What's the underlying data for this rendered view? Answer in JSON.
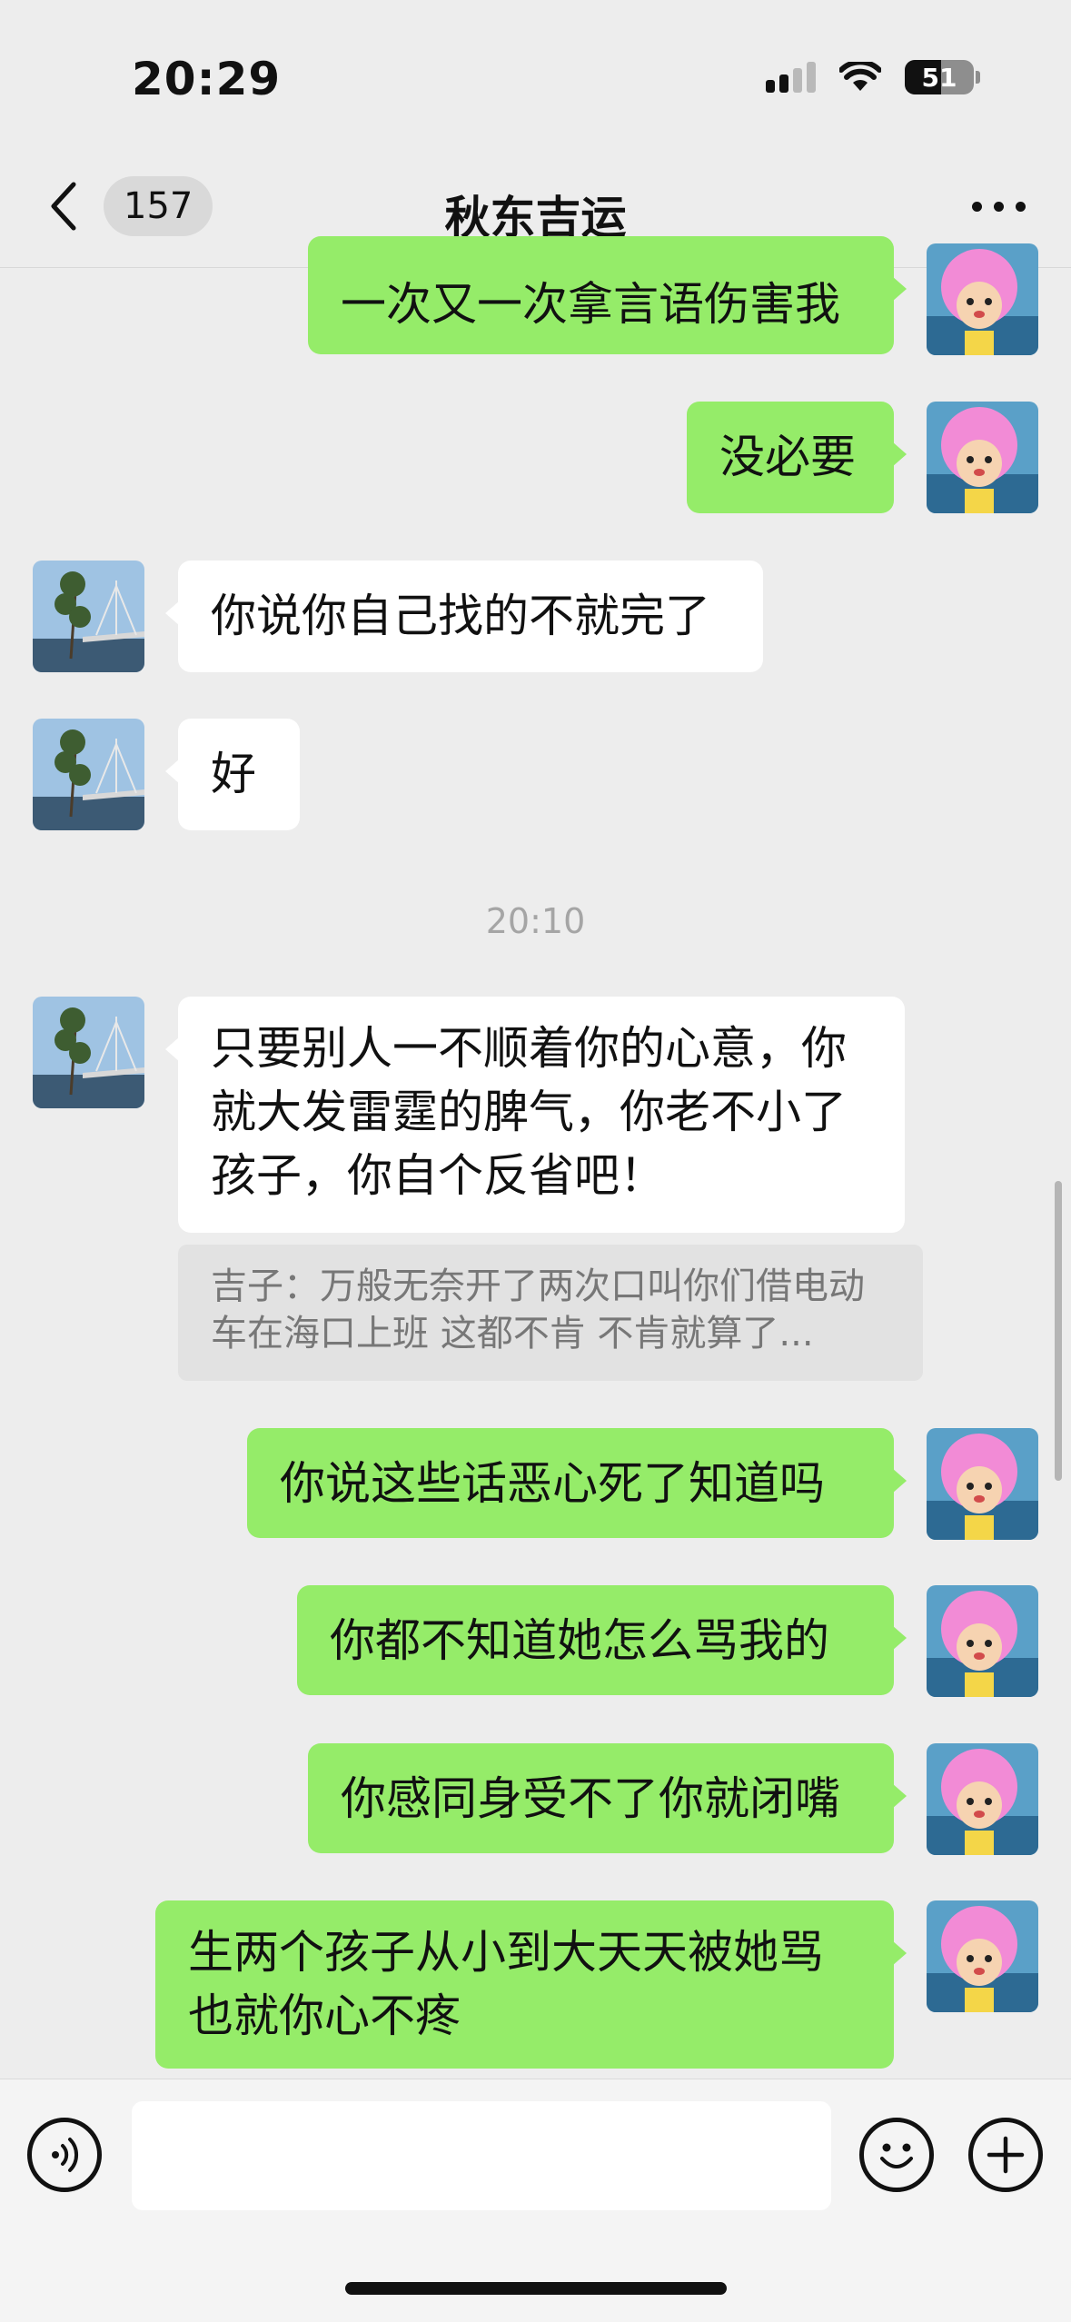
{
  "status_bar": {
    "time": "20:29",
    "battery": "51"
  },
  "header": {
    "unread_count": "157",
    "title": "秋东吉运"
  },
  "messages": [
    {
      "side": "right",
      "text": "一次又一次拿言语伤害我"
    },
    {
      "side": "right",
      "text": "没必要"
    },
    {
      "side": "left",
      "text": "你说你自己找的不就完了"
    },
    {
      "side": "left",
      "text": "好"
    },
    {
      "side": "left",
      "text": "只要别人一不顺着你的心意，你就大发雷霆的脾气，你老不小了孩子，你自个反省吧！"
    },
    {
      "side": "right",
      "text": "你说这些话恶心死了知道吗"
    },
    {
      "side": "right",
      "text": "你都不知道她怎么骂我的"
    },
    {
      "side": "right",
      "text": "你感同身受不了你就闭嘴"
    },
    {
      "side": "right",
      "text": "生两个孩子从小到大天天被她骂也就你心不疼"
    }
  ],
  "timestamp": "20:10",
  "quote": {
    "text": "吉子：万般无奈开了两次口叫你们借电动车在海口上班 这都不肯 不肯就算了..."
  }
}
